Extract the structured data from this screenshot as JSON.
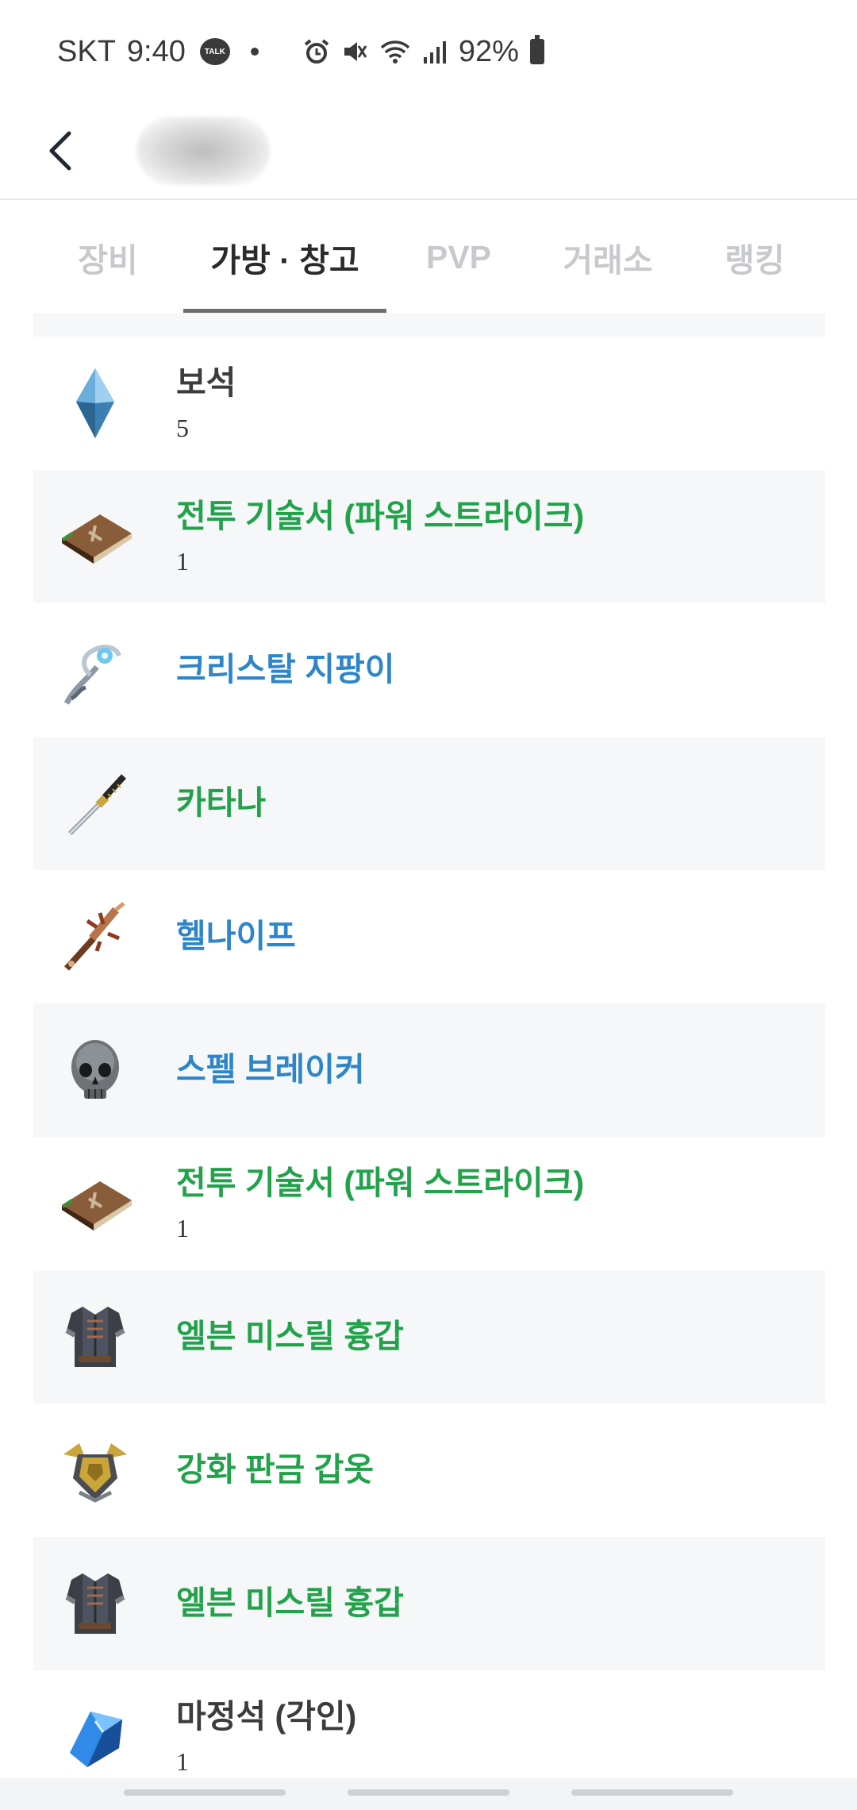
{
  "status_bar": {
    "carrier": "SKT",
    "time": "9:40",
    "talk_icon_text": "TALK",
    "battery_percent": "92%",
    "icons": [
      "kakaotalk-icon",
      "dot-icon",
      "alarm-icon",
      "mute-icon",
      "wifi-icon",
      "signal-icon",
      "battery-icon"
    ]
  },
  "header": {
    "back_icon": "chevron-left-icon"
  },
  "tabs": [
    {
      "label": "장비",
      "active": false
    },
    {
      "label": "가방 · 창고",
      "active": true
    },
    {
      "label": "PVP",
      "active": false
    },
    {
      "label": "거래소",
      "active": false
    },
    {
      "label": "랭킹",
      "active": false
    }
  ],
  "items": [
    {
      "name": "보석",
      "count": "5",
      "color": "#3c3c3c",
      "icon": "gem-icon"
    },
    {
      "name": "전투 기술서 (파워 스트라이크)",
      "count": "1",
      "color": "#22a24a",
      "icon": "skill-book-icon"
    },
    {
      "name": "크리스탈 지팡이",
      "count": "",
      "color": "#2e86c8",
      "icon": "crystal-staff-icon"
    },
    {
      "name": "카타나",
      "count": "",
      "color": "#22a24a",
      "icon": "katana-icon"
    },
    {
      "name": "헬나이프",
      "count": "",
      "color": "#2e86c8",
      "icon": "hell-knife-icon"
    },
    {
      "name": "스펠 브레이커",
      "count": "",
      "color": "#2e86c8",
      "icon": "skull-helmet-icon"
    },
    {
      "name": "전투 기술서 (파워 스트라이크)",
      "count": "1",
      "color": "#22a24a",
      "icon": "skill-book-icon"
    },
    {
      "name": "엘븐 미스릴 흉갑",
      "count": "",
      "color": "#22a24a",
      "icon": "chest-armor-icon"
    },
    {
      "name": "강화 판금 갑옷",
      "count": "",
      "color": "#22a24a",
      "icon": "plate-armor-icon"
    },
    {
      "name": "엘븐 미스릴 흉갑",
      "count": "",
      "color": "#22a24a",
      "icon": "chest-armor-icon"
    },
    {
      "name": "마정석 (각인)",
      "count": "1",
      "color": "#3c3c3c",
      "icon": "magic-stone-icon"
    }
  ]
}
